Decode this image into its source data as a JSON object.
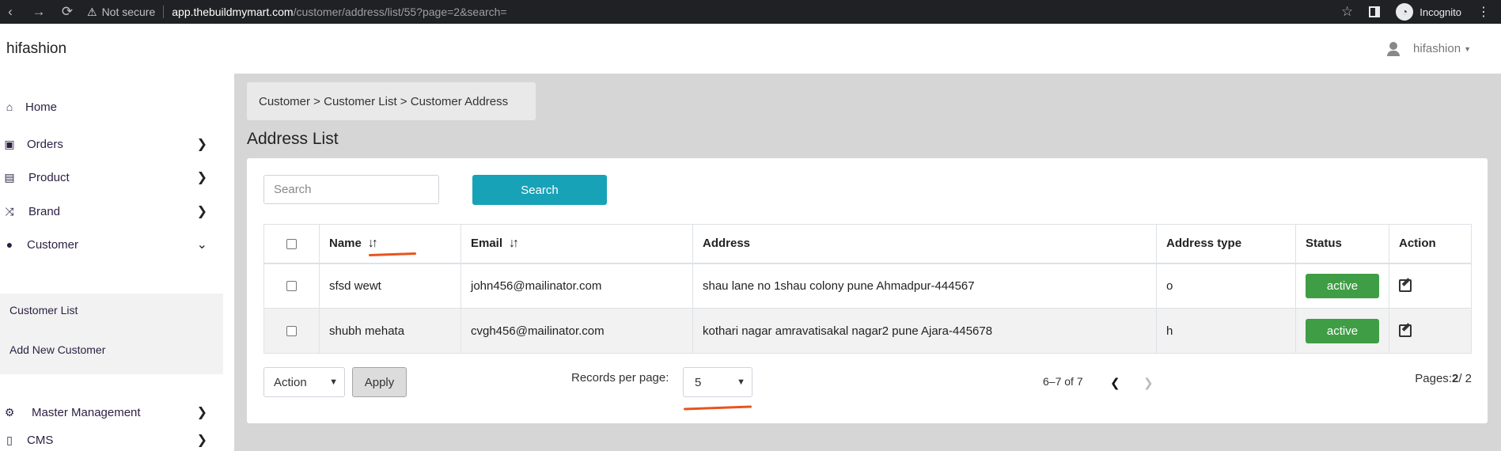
{
  "browser": {
    "not_secure": "Not secure",
    "url_host": "app.thebuildmymart.com",
    "url_path": "/customer/address/list/55?page=2&search=",
    "incognito": "Incognito"
  },
  "header": {
    "brand": "hifashion",
    "user": "hifashion"
  },
  "sidebar": {
    "items": [
      {
        "label": "Home",
        "icon": "home-icon"
      },
      {
        "label": "Orders",
        "icon": "shopping-bag-icon"
      },
      {
        "label": "Product",
        "icon": "archive-icon"
      },
      {
        "label": "Brand",
        "icon": "shuffle-icon"
      },
      {
        "label": "Customer",
        "icon": "user-icon"
      },
      {
        "label": "Master Management",
        "icon": "users-cog-icon"
      },
      {
        "label": "CMS",
        "icon": "file-icon"
      }
    ],
    "sub_items": [
      "Customer List",
      "Add New Customer"
    ]
  },
  "breadcrumb": "Customer > Customer List > Customer Address",
  "page_title": "Address List",
  "search": {
    "placeholder": "Search",
    "button": "Search"
  },
  "table": {
    "columns": [
      "Name",
      "Email",
      "Address",
      "Address type",
      "Status",
      "Action"
    ],
    "rows": [
      {
        "name": "sfsd wewt",
        "email": "john456@mailinator.com",
        "address": "shau lane no 1shau colony pune Ahmadpur-444567",
        "type": "o",
        "status": "active"
      },
      {
        "name": "shubh mehata",
        "email": "cvgh456@mailinator.com",
        "address": "kothari nagar amravatisakal nagar2 pune Ajara-445678",
        "type": "h",
        "status": "active"
      }
    ]
  },
  "footer": {
    "action_select": "Action",
    "apply": "Apply",
    "records_label": "Records per page:",
    "records_value": "5",
    "range": "6–7 of 7",
    "pages_label": "Pages:",
    "pages_current": "2",
    "pages_total": "/ 2"
  },
  "colors": {
    "accent": "#17a2b8",
    "status_active": "#3f9e45",
    "annotation": "#e8541c"
  }
}
